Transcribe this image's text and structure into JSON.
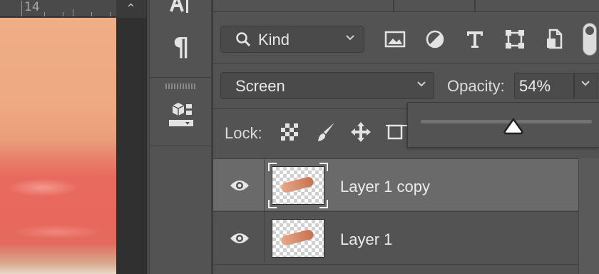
{
  "ruler": {
    "marker": "14"
  },
  "tool_panel": {
    "items": [
      {
        "icon": "character-icon"
      },
      {
        "icon": "paragraph-icon",
        "glyph": "¶"
      },
      {
        "icon": "3d-cube-icon"
      }
    ]
  },
  "layers_panel": {
    "filter": {
      "kind_label": "Kind",
      "icons": [
        "image-filter-icon",
        "adjustment-filter-icon",
        "type-filter-icon",
        "shape-filter-icon",
        "smart-object-filter-icon"
      ]
    },
    "blend_mode": "Screen",
    "opacity_label": "Opacity:",
    "opacity_value": "54%",
    "opacity_slider_level": 0.54,
    "lock_label": "Lock:",
    "lock_icons": [
      "lock-transparent-pixels-icon",
      "lock-image-pixels-icon",
      "lock-position-icon",
      "lock-artboard-icon"
    ],
    "layers": [
      {
        "name": "Layer 1 copy",
        "visible": true,
        "selected": true
      },
      {
        "name": "Layer 1",
        "visible": true,
        "selected": false
      }
    ]
  },
  "colors": {
    "panel_bg": "#535353",
    "selected_row": "#6a6a6a",
    "text": "#e6e6e6"
  }
}
